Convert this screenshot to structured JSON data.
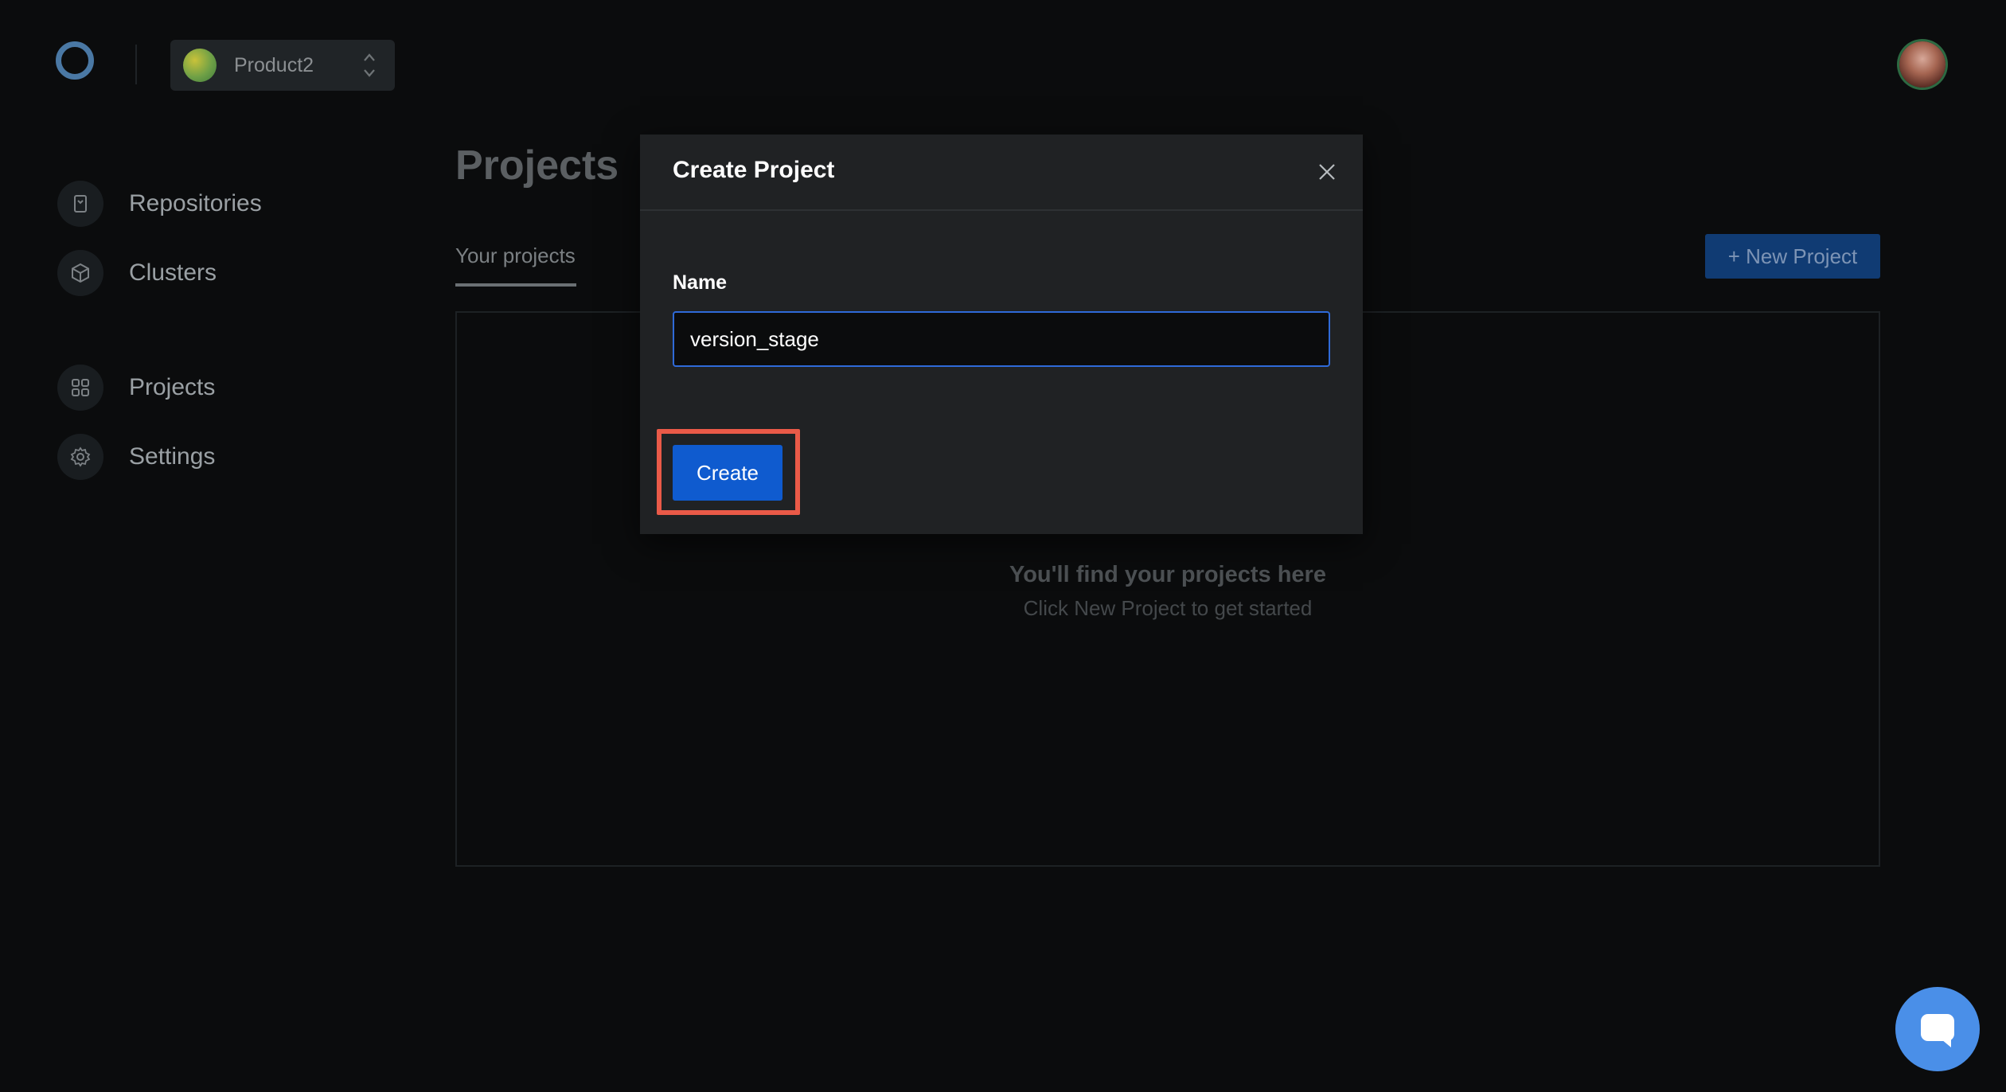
{
  "header": {
    "org_name": "Product2",
    "logo_icon": "ring-logo-icon",
    "user_avatar": "user-avatar"
  },
  "sidebar": {
    "items": [
      {
        "label": "Repositories",
        "icon": "bookmark-icon"
      },
      {
        "label": "Clusters",
        "icon": "cube-icon"
      },
      {
        "label": "Projects",
        "icon": "grid-icon"
      },
      {
        "label": "Settings",
        "icon": "gear-icon"
      }
    ]
  },
  "main": {
    "title": "Projects",
    "tab_label": "Your projects",
    "new_project_label": "+ New Project",
    "empty_title": "You'll find your projects here",
    "empty_subtitle": "Click New Project to get started"
  },
  "modal": {
    "title": "Create Project",
    "name_label": "Name",
    "name_value": "version_stage",
    "create_label": "Create"
  },
  "colors": {
    "accent": "#0f5bcf",
    "highlight": "#ea5a48",
    "background": "#0b0c0d"
  }
}
